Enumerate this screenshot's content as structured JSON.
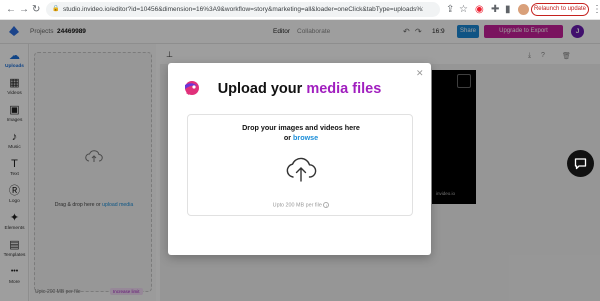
{
  "browser": {
    "url": "studio.invideo.io/editor?id=10456&dimension=16%3A9&workflow=story&marketing=all&loader=oneClick&tabType=uploads%3F&vi...",
    "relaunch_label": "Relaunch to update"
  },
  "editor": {
    "breadcrumb_root": "Projects",
    "project_id": "24469989",
    "mode_tabs": [
      "Editor",
      "Collaborate"
    ],
    "aspect": "16:9",
    "share_label": "Share",
    "export_label": "Upgrade to Export",
    "avatar_initial": "J",
    "rail_items": [
      {
        "label": "Uploads",
        "icon": "☁"
      },
      {
        "label": "Videos",
        "icon": "▦"
      },
      {
        "label": "Images",
        "icon": "▣"
      },
      {
        "label": "Music",
        "icon": "♪"
      },
      {
        "label": "Text",
        "icon": "T"
      },
      {
        "label": "Logo",
        "icon": "Ⓡ"
      },
      {
        "label": "Elements",
        "icon": "✦"
      },
      {
        "label": "Templates",
        "icon": "▤"
      },
      {
        "label": "More",
        "icon": "•••"
      }
    ],
    "panel_drop_text": "Drag & drop here or",
    "panel_drop_link": "upload media",
    "panel_limit": "Upto 200 MB per file",
    "panel_badge": "Increase limit",
    "preview_watermark": "invideo.io"
  },
  "modal": {
    "title_prefix": "Upload your ",
    "title_highlight": "media files",
    "drop_line1": "Drop your images and videos here",
    "drop_line2_prefix": "or ",
    "drop_line2_link": "browse",
    "limit_text": "Upto 200 MB per file",
    "colors": {
      "highlight": "#a11fbf",
      "link": "#1a8dd8"
    }
  }
}
